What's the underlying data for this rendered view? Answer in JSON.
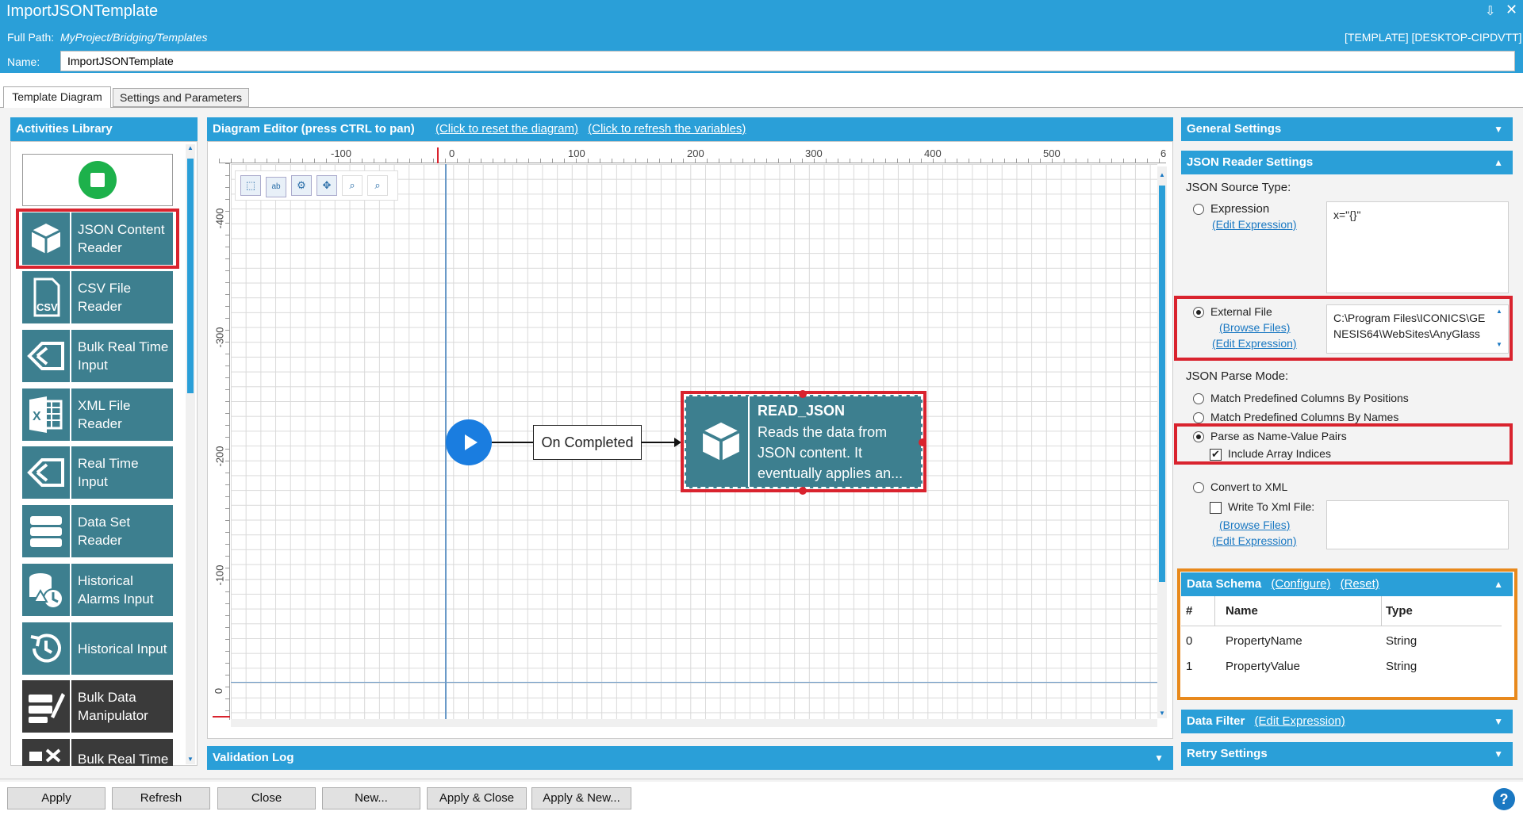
{
  "window": {
    "title": "ImportJSONTemplate",
    "full_path_label": "Full Path:",
    "full_path_value": "MyProject/Bridging/Templates",
    "right_info": "[TEMPLATE] [DESKTOP-CIPDVTT]",
    "name_label": "Name:",
    "name_value": "ImportJSONTemplate"
  },
  "tabs": [
    {
      "label": "Template Diagram"
    },
    {
      "label": "Settings and Parameters"
    }
  ],
  "library": {
    "title": "Activities Library",
    "items": [
      {
        "label": "JSON Content Reader",
        "icon": "json-box-icon"
      },
      {
        "label": "CSV File Reader",
        "icon": "csv-file-icon"
      },
      {
        "label": "Bulk Real Time Input",
        "icon": "tag-icon"
      },
      {
        "label": "XML File Reader",
        "icon": "excel-icon"
      },
      {
        "label": "Real Time Input",
        "icon": "tag-icon"
      },
      {
        "label": "Data Set Reader",
        "icon": "dataset-icon"
      },
      {
        "label": "Historical Alarms Input",
        "icon": "alarm-history-icon"
      },
      {
        "label": "Historical Input",
        "icon": "history-icon"
      },
      {
        "label": "Bulk Data Manipulator",
        "icon": "edit-data-icon"
      },
      {
        "label": "Bulk Real Time",
        "icon": "bulk-icon"
      }
    ]
  },
  "diagram": {
    "title": "Diagram Editor (press CTRL to pan)",
    "reset_link": "(Click to reset the diagram)",
    "refresh_link": "(Click to refresh the variables)",
    "ruler_x": [
      "-100",
      "0",
      "100",
      "200",
      "300",
      "400",
      "500",
      "6"
    ],
    "ruler_y": [
      "-400",
      "-300",
      "-200",
      "-100",
      "0"
    ],
    "connector_label": "On Completed",
    "node_title": "READ_JSON",
    "node_desc": "Reads the data from JSON content. It eventually applies an..."
  },
  "validation_log": {
    "title": "Validation Log"
  },
  "settings": {
    "general_title": "General Settings",
    "json_reader_title": "JSON Reader Settings",
    "source_type_label": "JSON Source Type:",
    "expression_label": "Expression",
    "edit_expression": "(Edit Expression)",
    "expression_value": "x=\"{}\"",
    "external_file_label": "External File",
    "browse_files": "(Browse Files)",
    "external_file_value": "C:\\Program Files\\ICONICS\\GENESIS64\\WebSites\\AnyGlass",
    "parse_mode_label": "JSON Parse Mode:",
    "opt_positions": "Match Predefined Columns By Positions",
    "opt_names": "Match Predefined Columns By Names",
    "opt_name_value": "Parse as Name-Value Pairs",
    "include_array": "Include Array Indices",
    "convert_xml": "Convert to XML",
    "write_xml": "Write To Xml File:"
  },
  "schema": {
    "title": "Data Schema",
    "configure": "(Configure)",
    "reset": "(Reset)",
    "col_index": "#",
    "col_name": "Name",
    "col_type": "Type",
    "rows": [
      {
        "idx": "0",
        "name": "PropertyName",
        "type": "String"
      },
      {
        "idx": "1",
        "name": "PropertyValue",
        "type": "String"
      }
    ]
  },
  "data_filter": {
    "title": "Data Filter",
    "link": "(Edit Expression)"
  },
  "retry": {
    "title": "Retry Settings"
  },
  "buttons": [
    "Apply",
    "Refresh",
    "Close",
    "New...",
    "Apply & Close",
    "Apply & New..."
  ],
  "colors": {
    "accent": "#2a9fd8",
    "tile": "#3d7f8f",
    "highlight_red": "#d9232e",
    "highlight_orange": "#e8891c"
  }
}
